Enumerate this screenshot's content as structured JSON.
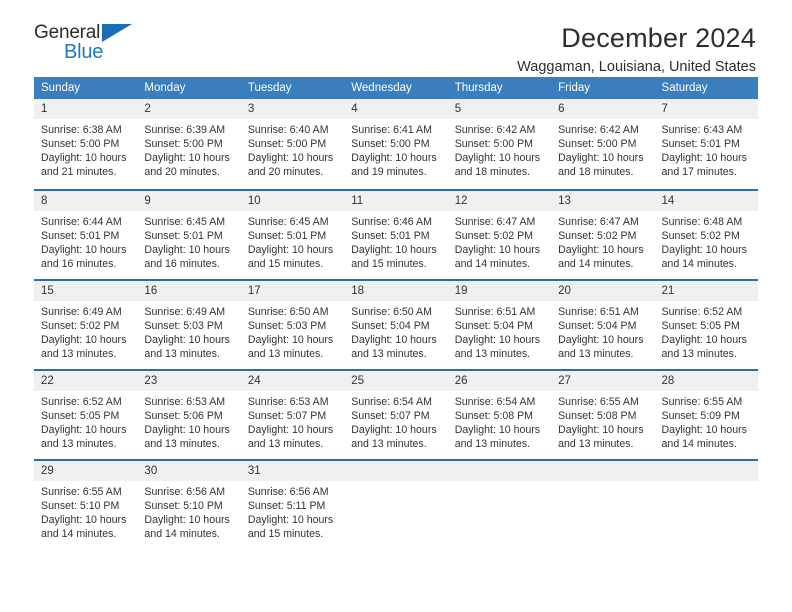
{
  "logo": {
    "word_top": "General",
    "word_bottom": "Blue",
    "triangle_icon": "blue-triangle-icon",
    "accent_color": "#1b6eb5"
  },
  "header": {
    "title": "December 2024",
    "subtitle": "Waggaman, Louisiana, United States"
  },
  "theme": {
    "header_blue": "#3b7ebe",
    "row_line_blue": "#2e6da4",
    "daynum_bg": "#f0f0f0",
    "text": "#333333"
  },
  "calendar": {
    "weekday_headers": [
      "Sunday",
      "Monday",
      "Tuesday",
      "Wednesday",
      "Thursday",
      "Friday",
      "Saturday"
    ],
    "weeks": [
      [
        {
          "day": "1",
          "sunrise": "Sunrise: 6:38 AM",
          "sunset": "Sunset: 5:00 PM",
          "daylight_l1": "Daylight: 10 hours",
          "daylight_l2": "and 21 minutes."
        },
        {
          "day": "2",
          "sunrise": "Sunrise: 6:39 AM",
          "sunset": "Sunset: 5:00 PM",
          "daylight_l1": "Daylight: 10 hours",
          "daylight_l2": "and 20 minutes."
        },
        {
          "day": "3",
          "sunrise": "Sunrise: 6:40 AM",
          "sunset": "Sunset: 5:00 PM",
          "daylight_l1": "Daylight: 10 hours",
          "daylight_l2": "and 20 minutes."
        },
        {
          "day": "4",
          "sunrise": "Sunrise: 6:41 AM",
          "sunset": "Sunset: 5:00 PM",
          "daylight_l1": "Daylight: 10 hours",
          "daylight_l2": "and 19 minutes."
        },
        {
          "day": "5",
          "sunrise": "Sunrise: 6:42 AM",
          "sunset": "Sunset: 5:00 PM",
          "daylight_l1": "Daylight: 10 hours",
          "daylight_l2": "and 18 minutes."
        },
        {
          "day": "6",
          "sunrise": "Sunrise: 6:42 AM",
          "sunset": "Sunset: 5:00 PM",
          "daylight_l1": "Daylight: 10 hours",
          "daylight_l2": "and 18 minutes."
        },
        {
          "day": "7",
          "sunrise": "Sunrise: 6:43 AM",
          "sunset": "Sunset: 5:01 PM",
          "daylight_l1": "Daylight: 10 hours",
          "daylight_l2": "and 17 minutes."
        }
      ],
      [
        {
          "day": "8",
          "sunrise": "Sunrise: 6:44 AM",
          "sunset": "Sunset: 5:01 PM",
          "daylight_l1": "Daylight: 10 hours",
          "daylight_l2": "and 16 minutes."
        },
        {
          "day": "9",
          "sunrise": "Sunrise: 6:45 AM",
          "sunset": "Sunset: 5:01 PM",
          "daylight_l1": "Daylight: 10 hours",
          "daylight_l2": "and 16 minutes."
        },
        {
          "day": "10",
          "sunrise": "Sunrise: 6:45 AM",
          "sunset": "Sunset: 5:01 PM",
          "daylight_l1": "Daylight: 10 hours",
          "daylight_l2": "and 15 minutes."
        },
        {
          "day": "11",
          "sunrise": "Sunrise: 6:46 AM",
          "sunset": "Sunset: 5:01 PM",
          "daylight_l1": "Daylight: 10 hours",
          "daylight_l2": "and 15 minutes."
        },
        {
          "day": "12",
          "sunrise": "Sunrise: 6:47 AM",
          "sunset": "Sunset: 5:02 PM",
          "daylight_l1": "Daylight: 10 hours",
          "daylight_l2": "and 14 minutes."
        },
        {
          "day": "13",
          "sunrise": "Sunrise: 6:47 AM",
          "sunset": "Sunset: 5:02 PM",
          "daylight_l1": "Daylight: 10 hours",
          "daylight_l2": "and 14 minutes."
        },
        {
          "day": "14",
          "sunrise": "Sunrise: 6:48 AM",
          "sunset": "Sunset: 5:02 PM",
          "daylight_l1": "Daylight: 10 hours",
          "daylight_l2": "and 14 minutes."
        }
      ],
      [
        {
          "day": "15",
          "sunrise": "Sunrise: 6:49 AM",
          "sunset": "Sunset: 5:02 PM",
          "daylight_l1": "Daylight: 10 hours",
          "daylight_l2": "and 13 minutes."
        },
        {
          "day": "16",
          "sunrise": "Sunrise: 6:49 AM",
          "sunset": "Sunset: 5:03 PM",
          "daylight_l1": "Daylight: 10 hours",
          "daylight_l2": "and 13 minutes."
        },
        {
          "day": "17",
          "sunrise": "Sunrise: 6:50 AM",
          "sunset": "Sunset: 5:03 PM",
          "daylight_l1": "Daylight: 10 hours",
          "daylight_l2": "and 13 minutes."
        },
        {
          "day": "18",
          "sunrise": "Sunrise: 6:50 AM",
          "sunset": "Sunset: 5:04 PM",
          "daylight_l1": "Daylight: 10 hours",
          "daylight_l2": "and 13 minutes."
        },
        {
          "day": "19",
          "sunrise": "Sunrise: 6:51 AM",
          "sunset": "Sunset: 5:04 PM",
          "daylight_l1": "Daylight: 10 hours",
          "daylight_l2": "and 13 minutes."
        },
        {
          "day": "20",
          "sunrise": "Sunrise: 6:51 AM",
          "sunset": "Sunset: 5:04 PM",
          "daylight_l1": "Daylight: 10 hours",
          "daylight_l2": "and 13 minutes."
        },
        {
          "day": "21",
          "sunrise": "Sunrise: 6:52 AM",
          "sunset": "Sunset: 5:05 PM",
          "daylight_l1": "Daylight: 10 hours",
          "daylight_l2": "and 13 minutes."
        }
      ],
      [
        {
          "day": "22",
          "sunrise": "Sunrise: 6:52 AM",
          "sunset": "Sunset: 5:05 PM",
          "daylight_l1": "Daylight: 10 hours",
          "daylight_l2": "and 13 minutes."
        },
        {
          "day": "23",
          "sunrise": "Sunrise: 6:53 AM",
          "sunset": "Sunset: 5:06 PM",
          "daylight_l1": "Daylight: 10 hours",
          "daylight_l2": "and 13 minutes."
        },
        {
          "day": "24",
          "sunrise": "Sunrise: 6:53 AM",
          "sunset": "Sunset: 5:07 PM",
          "daylight_l1": "Daylight: 10 hours",
          "daylight_l2": "and 13 minutes."
        },
        {
          "day": "25",
          "sunrise": "Sunrise: 6:54 AM",
          "sunset": "Sunset: 5:07 PM",
          "daylight_l1": "Daylight: 10 hours",
          "daylight_l2": "and 13 minutes."
        },
        {
          "day": "26",
          "sunrise": "Sunrise: 6:54 AM",
          "sunset": "Sunset: 5:08 PM",
          "daylight_l1": "Daylight: 10 hours",
          "daylight_l2": "and 13 minutes."
        },
        {
          "day": "27",
          "sunrise": "Sunrise: 6:55 AM",
          "sunset": "Sunset: 5:08 PM",
          "daylight_l1": "Daylight: 10 hours",
          "daylight_l2": "and 13 minutes."
        },
        {
          "day": "28",
          "sunrise": "Sunrise: 6:55 AM",
          "sunset": "Sunset: 5:09 PM",
          "daylight_l1": "Daylight: 10 hours",
          "daylight_l2": "and 14 minutes."
        }
      ],
      [
        {
          "day": "29",
          "sunrise": "Sunrise: 6:55 AM",
          "sunset": "Sunset: 5:10 PM",
          "daylight_l1": "Daylight: 10 hours",
          "daylight_l2": "and 14 minutes."
        },
        {
          "day": "30",
          "sunrise": "Sunrise: 6:56 AM",
          "sunset": "Sunset: 5:10 PM",
          "daylight_l1": "Daylight: 10 hours",
          "daylight_l2": "and 14 minutes."
        },
        {
          "day": "31",
          "sunrise": "Sunrise: 6:56 AM",
          "sunset": "Sunset: 5:11 PM",
          "daylight_l1": "Daylight: 10 hours",
          "daylight_l2": "and 15 minutes."
        },
        {
          "day": "",
          "sunrise": "",
          "sunset": "",
          "daylight_l1": "",
          "daylight_l2": ""
        },
        {
          "day": "",
          "sunrise": "",
          "sunset": "",
          "daylight_l1": "",
          "daylight_l2": ""
        },
        {
          "day": "",
          "sunrise": "",
          "sunset": "",
          "daylight_l1": "",
          "daylight_l2": ""
        },
        {
          "day": "",
          "sunrise": "",
          "sunset": "",
          "daylight_l1": "",
          "daylight_l2": ""
        }
      ]
    ]
  }
}
